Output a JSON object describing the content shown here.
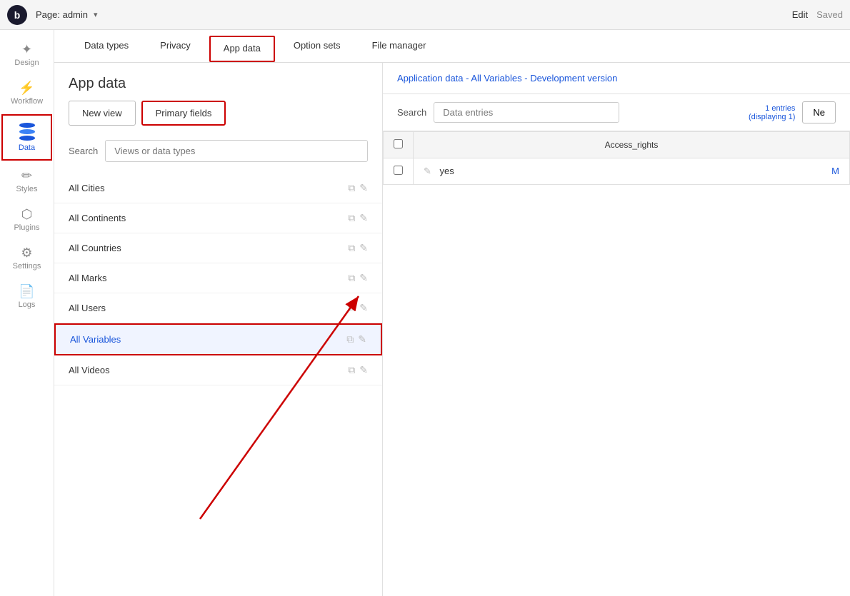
{
  "topbar": {
    "logo": "b",
    "page_label": "Page: admin",
    "dropdown_arrow": "▾",
    "edit_label": "Edit",
    "saved_label": "Saved"
  },
  "sidebar": {
    "items": [
      {
        "id": "design",
        "label": "Design",
        "icon": "✦"
      },
      {
        "id": "workflow",
        "label": "Workflow",
        "icon": "⚡"
      },
      {
        "id": "data",
        "label": "Data",
        "icon": "database",
        "active": true
      },
      {
        "id": "styles",
        "label": "Styles",
        "icon": "✏"
      },
      {
        "id": "plugins",
        "label": "Plugins",
        "icon": "🔌"
      },
      {
        "id": "settings",
        "label": "Settings",
        "icon": "⚙"
      },
      {
        "id": "logs",
        "label": "Logs",
        "icon": "📄"
      }
    ]
  },
  "tabs": [
    {
      "id": "data-types",
      "label": "Data types"
    },
    {
      "id": "privacy",
      "label": "Privacy"
    },
    {
      "id": "app-data",
      "label": "App data",
      "active": true
    },
    {
      "id": "option-sets",
      "label": "Option sets"
    },
    {
      "id": "file-manager",
      "label": "File manager"
    }
  ],
  "left_panel": {
    "heading": "App data",
    "new_view_btn": "New view",
    "primary_fields_btn": "Primary fields",
    "search_label": "Search",
    "search_placeholder": "Views or data types",
    "list_items": [
      {
        "id": "all-cities",
        "label": "All Cities",
        "selected": false
      },
      {
        "id": "all-continents",
        "label": "All Continents",
        "selected": false
      },
      {
        "id": "all-countries",
        "label": "All Countries",
        "selected": false
      },
      {
        "id": "all-marks",
        "label": "All Marks",
        "selected": false
      },
      {
        "id": "all-users",
        "label": "All Users",
        "selected": false
      },
      {
        "id": "all-variables",
        "label": "All Variables",
        "selected": true
      },
      {
        "id": "all-videos",
        "label": "All Videos",
        "selected": false
      }
    ]
  },
  "right_panel": {
    "breadcrumb": "Application data - All Variables - Development version",
    "search_label": "Search",
    "search_placeholder": "Data entries",
    "entries_line1": "1 entries",
    "entries_line2": "(displaying 1)",
    "new_entry_btn": "Ne",
    "table": {
      "columns": [
        {
          "id": "checkbox",
          "label": ""
        },
        {
          "id": "access_rights",
          "label": "Access_rights"
        }
      ],
      "rows": [
        {
          "checkbox": false,
          "access_rights": "yes",
          "more": "M"
        }
      ]
    }
  }
}
